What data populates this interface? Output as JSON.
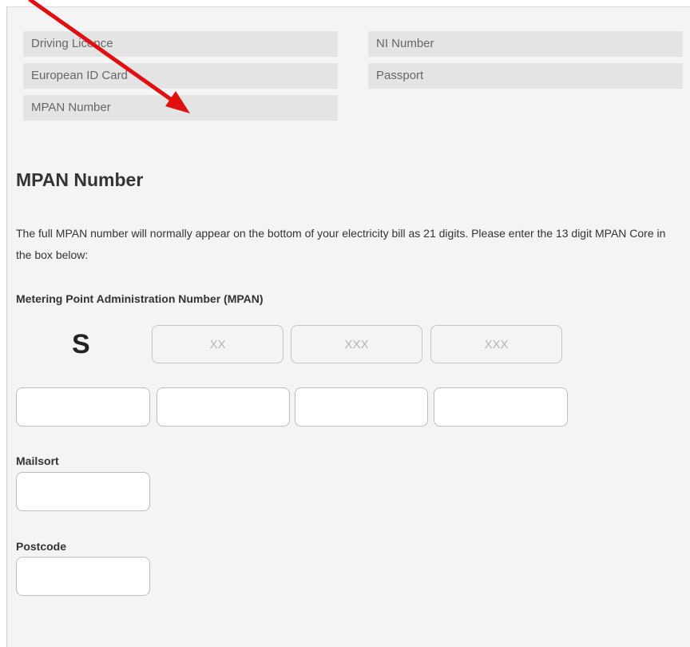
{
  "documents": {
    "options": [
      "Driving Licence",
      "NI Number",
      "European ID Card",
      "Passport",
      "MPAN Number"
    ]
  },
  "section": {
    "title": "MPAN Number",
    "intro": "The full MPAN number will normally appear on the bottom of your electricity bill as 21 digits. Please enter the 13 digit MPAN Core in the box below:"
  },
  "mpan": {
    "label": "Metering Point Administration Number (MPAN)",
    "prefix": "S",
    "top_placeholders": [
      "XX",
      "XXX",
      "XXX"
    ],
    "core_values": [
      "",
      "",
      "",
      ""
    ]
  },
  "mailsort": {
    "label": "Mailsort",
    "value": ""
  },
  "postcode": {
    "label": "Postcode",
    "value": ""
  },
  "colors": {
    "panel_bg": "#f4f4f4",
    "option_bg": "#e4e4e4",
    "annotation_arrow": "#e01010"
  },
  "annotation": {
    "icon": "red-arrow-icon"
  }
}
